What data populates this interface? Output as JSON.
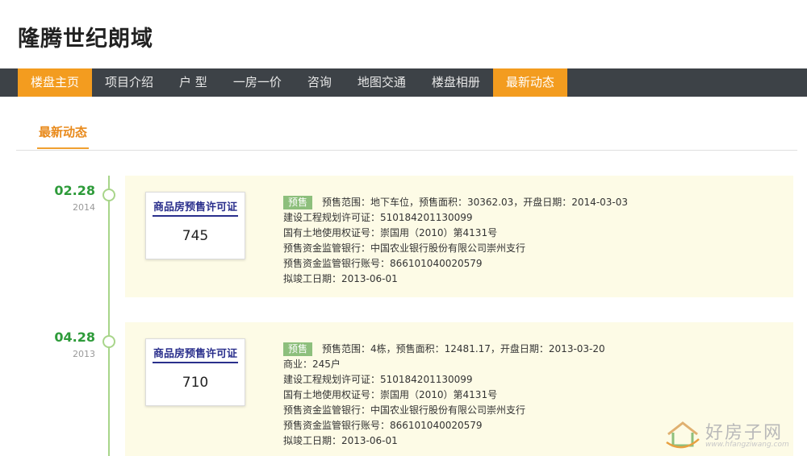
{
  "site": {
    "title": "隆腾世纪朗域"
  },
  "nav": {
    "items": [
      {
        "label": "楼盘主页",
        "active": true
      },
      {
        "label": "项目介绍",
        "active": false
      },
      {
        "label": "户 型",
        "active": false
      },
      {
        "label": "一房一价",
        "active": false
      },
      {
        "label": "咨询",
        "active": false
      },
      {
        "label": "地图交通",
        "active": false
      },
      {
        "label": "楼盘相册",
        "active": false
      },
      {
        "label": "最新动态",
        "active": true
      }
    ],
    "active_color": "#f39c1f",
    "bar_color": "#3d4247"
  },
  "section": {
    "tab_label": "最新动态"
  },
  "timeline": {
    "entries": [
      {
        "date": "02.28",
        "year": "2014",
        "permit": {
          "title": "商品房预售许可证",
          "number": "745"
        },
        "tag": "预售",
        "lines": [
          "预售范围：地下车位，预售面积：30362.03，开盘日期：2014-03-03",
          "建设工程规划许可证：510184201130099",
          "国有土地使用权证号：崇国用（2010）第4131号",
          "预售资金监管银行：中国农业银行股份有限公司崇州支行",
          "预售资金监管银行账号：866101040020579",
          "拟竣工日期：2013-06-01"
        ]
      },
      {
        "date": "04.28",
        "year": "2013",
        "permit": {
          "title": "商品房预售许可证",
          "number": "710"
        },
        "tag": "预售",
        "lines": [
          "预售范围：4栋，预售面积：12481.17，开盘日期：2013-03-20",
          "商业：245户",
          "建设工程规划许可证：510184201130099",
          "国有土地使用权证号：崇国用（2010）第4131号",
          "预售资金监管银行：中国农业银行股份有限公司崇州支行",
          "预售资金监管银行账号：866101040020579",
          "拟竣工日期：2013-06-01"
        ]
      }
    ]
  },
  "watermark": {
    "text": "好房子网",
    "url": "www.hfangziwang.com"
  },
  "colors": {
    "date_green": "#2e9b3a",
    "timeline_green": "#a8d58a",
    "card_bg": "#fdfbe6",
    "tag_green": "#8dbf7c",
    "accent_orange": "#e8891a"
  }
}
